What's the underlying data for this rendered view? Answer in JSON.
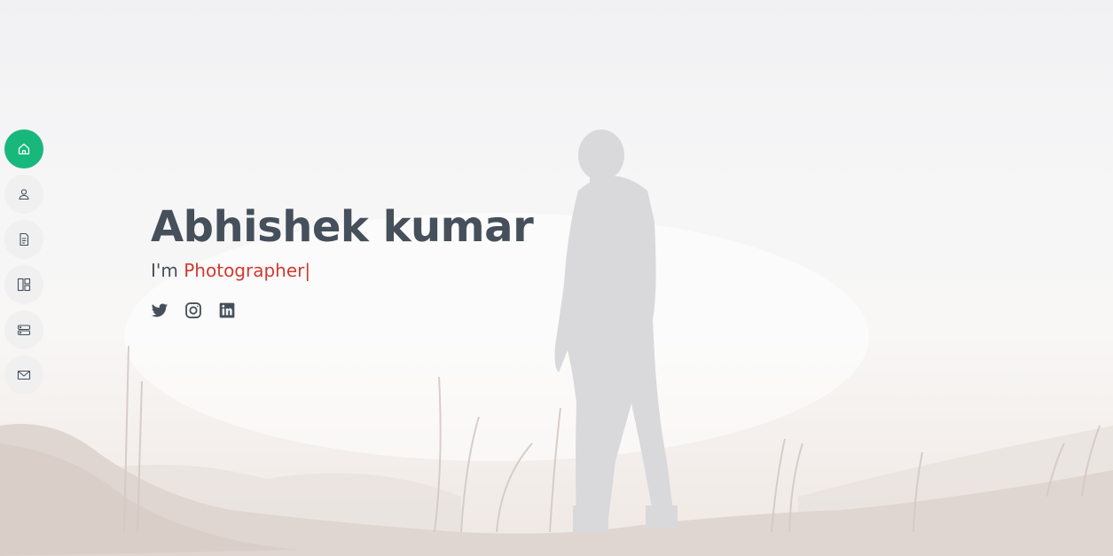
{
  "hero": {
    "name": "Abhishek kumar",
    "tagline_prefix": "I'm ",
    "role": "Photographer",
    "caret": "|"
  },
  "nav": {
    "items": [
      {
        "icon": "home-icon",
        "active": true
      },
      {
        "icon": "person-icon",
        "active": false
      },
      {
        "icon": "file-text-icon",
        "active": false
      },
      {
        "icon": "portfolio-icon",
        "active": false
      },
      {
        "icon": "server-icon",
        "active": false
      },
      {
        "icon": "envelope-icon",
        "active": false
      }
    ]
  },
  "socials": [
    {
      "icon": "twitter-icon"
    },
    {
      "icon": "instagram-icon"
    },
    {
      "icon": "linkedin-icon"
    }
  ],
  "colors": {
    "accent": "#18b87d",
    "heading": "#45505b",
    "role": "#d03a31"
  }
}
